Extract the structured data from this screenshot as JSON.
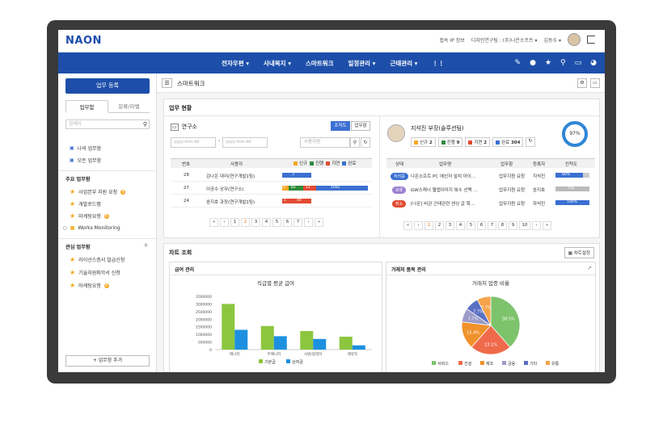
{
  "top": {
    "logo": "NAON",
    "links": [
      "접속 IP 정보",
      "디자인연구팀 : (주)나온소프트 ▾",
      "김동수 ▾"
    ]
  },
  "nav": {
    "menu": [
      "전자우편 ▾",
      "사내복지 ▾",
      "스마트워크",
      "일정관리 ▾",
      "근태관리 ▾"
    ],
    "icons": [
      "pen-icon",
      "chat-icon",
      "star-icon",
      "search-icon",
      "monitor-icon",
      "palette-icon"
    ]
  },
  "sidebar": {
    "register": "업무 등록",
    "tabs": [
      "업무함",
      "문류/라벨"
    ],
    "search_placeholder": "검색어",
    "my": [
      "나의 업무함",
      "모든 업무함"
    ],
    "main_head": "주요 업무함",
    "main_items": [
      "사업본부 지원 요청",
      "개발로드맵",
      "마케팅요청",
      "Works Monitoring"
    ],
    "int_head": "관심 업무함",
    "int_items": [
      "라이선스증서 발급신청",
      "기술지원파악서 신청",
      "마케팅요청"
    ],
    "add": "+ 업무함 추가"
  },
  "crumb": {
    "title": "스마트워크"
  },
  "status": {
    "title": "업무 현황",
    "org": "연구소",
    "btn_org": "조직도",
    "btn_box": "업무함",
    "date_ph": "yyyy-mm-dd",
    "user_ph": "사용자명",
    "headers": [
      "번호",
      "사용자",
      "진행"
    ],
    "legend": [
      "신규",
      "진행",
      "지연",
      "완료"
    ],
    "rows": [
      {
        "no": "28",
        "user": "김나온 대리(연구개발1팀)",
        "bars": [
          "3"
        ]
      },
      {
        "no": "27",
        "user": "이공수 상무(연구소)",
        "bars": [
          "6",
          "82",
          "12",
          "1092"
        ]
      },
      {
        "no": "24",
        "user": "송지호 과장(연구개발1팀)",
        "bars": [
          "5",
          "49"
        ]
      }
    ],
    "pages": [
      "«",
      "‹",
      "1",
      "2",
      "3",
      "4",
      "5",
      "6",
      "7",
      "›",
      "»"
    ]
  },
  "person": {
    "name": "지석진 부장(솔루션팀)",
    "stats": [
      {
        "label": "신규",
        "v": "2"
      },
      {
        "label": "진행",
        "v": "9"
      },
      {
        "label": "지연",
        "v": "2"
      },
      {
        "label": "완료",
        "v": "304"
      }
    ],
    "percent": "97%",
    "headers": [
      "상태",
      "업무명",
      "업무함",
      "등록자",
      "진척도"
    ],
    "rows": [
      {
        "state": "처리중",
        "title": "나온소프트 PC 에선저 설치 아이…",
        "box": "업무지원 요청",
        "reg": "지석진",
        "prog": "80%",
        "pct": 80
      },
      {
        "state": "보류",
        "title": "GW스케너 웹앱이미지 복수 선택 …",
        "box": "업무지원 요청",
        "reg": "송지호",
        "prog": "0%",
        "pct": 0
      },
      {
        "state": "취소",
        "title": "[나온] 비관 근태관련 센싱 값 확…",
        "box": "업무지원 요청",
        "reg": "하석진",
        "prog": "100%",
        "pct": 100
      }
    ],
    "pages": [
      "«",
      "‹",
      "1",
      "2",
      "3",
      "4",
      "5",
      "6",
      "7",
      "8",
      "9",
      "10",
      "›",
      "»"
    ]
  },
  "charts": {
    "title": "차트 조회",
    "setting": "차트설정",
    "left_panel": "급여 관리",
    "right_panel": "거래처 품목 관리"
  },
  "chart_data": [
    {
      "type": "bar",
      "title": "직급별 평균 급여",
      "categories": [
        "매니저",
        "부매니저",
        "사원/협력자",
        "계약직"
      ],
      "series": [
        {
          "name": "기본급",
          "values": [
            3000000,
            1550000,
            1220000,
            850000
          ]
        },
        {
          "name": "상여금",
          "values": [
            1300000,
            880000,
            700000,
            280000
          ]
        }
      ],
      "ylim": [
        0,
        3500000
      ],
      "yticks": [
        "3500000",
        "3000000",
        "2500000",
        "2000000",
        "1500000",
        "1000000",
        "500000",
        "0"
      ]
    },
    {
      "type": "pie",
      "title": "거래처 업종 비율",
      "labels": [
        "서비스",
        "건설",
        "제조",
        "금융",
        "기타",
        "유통"
      ],
      "values": [
        38.5,
        23.1,
        15.4,
        7.7,
        7.7,
        7.7
      ],
      "colors": [
        "#7dc36b",
        "#ef6a4b",
        "#f0922c",
        "#9b9bc9",
        "#5b6fc3",
        "#f5a34a"
      ]
    }
  ]
}
